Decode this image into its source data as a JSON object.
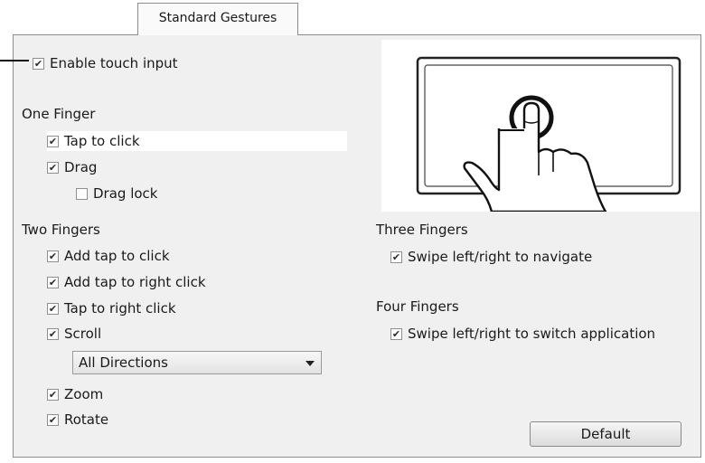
{
  "tab": {
    "label": "Standard Gestures"
  },
  "enable_touch": {
    "label": "Enable touch input",
    "checked": true
  },
  "one_finger": {
    "title": "One Finger",
    "tap_to_click": {
      "label": "Tap to click",
      "checked": true
    },
    "drag": {
      "label": "Drag",
      "checked": true
    },
    "drag_lock": {
      "label": "Drag lock",
      "checked": false
    }
  },
  "two_fingers": {
    "title": "Two Fingers",
    "add_tap_to_click": {
      "label": "Add tap to click",
      "checked": true
    },
    "add_tap_to_right_click": {
      "label": "Add tap to right click",
      "checked": true
    },
    "tap_to_right_click": {
      "label": "Tap to right click",
      "checked": true
    },
    "scroll": {
      "label": "Scroll",
      "checked": true
    },
    "scroll_direction": {
      "selected": "All Directions"
    },
    "zoom": {
      "label": "Zoom",
      "checked": true
    },
    "rotate": {
      "label": "Rotate",
      "checked": true
    }
  },
  "three_fingers": {
    "title": "Three Fingers",
    "swipe_navigate": {
      "label": "Swipe left/right to navigate",
      "checked": true
    }
  },
  "four_fingers": {
    "title": "Four Fingers",
    "swipe_switch": {
      "label": "Swipe left/right to switch application",
      "checked": true
    }
  },
  "default_button": {
    "label": "Default"
  },
  "icons": {
    "preview": "touchpad-tap-gesture-icon",
    "dropdown": "chevron-down-icon"
  }
}
